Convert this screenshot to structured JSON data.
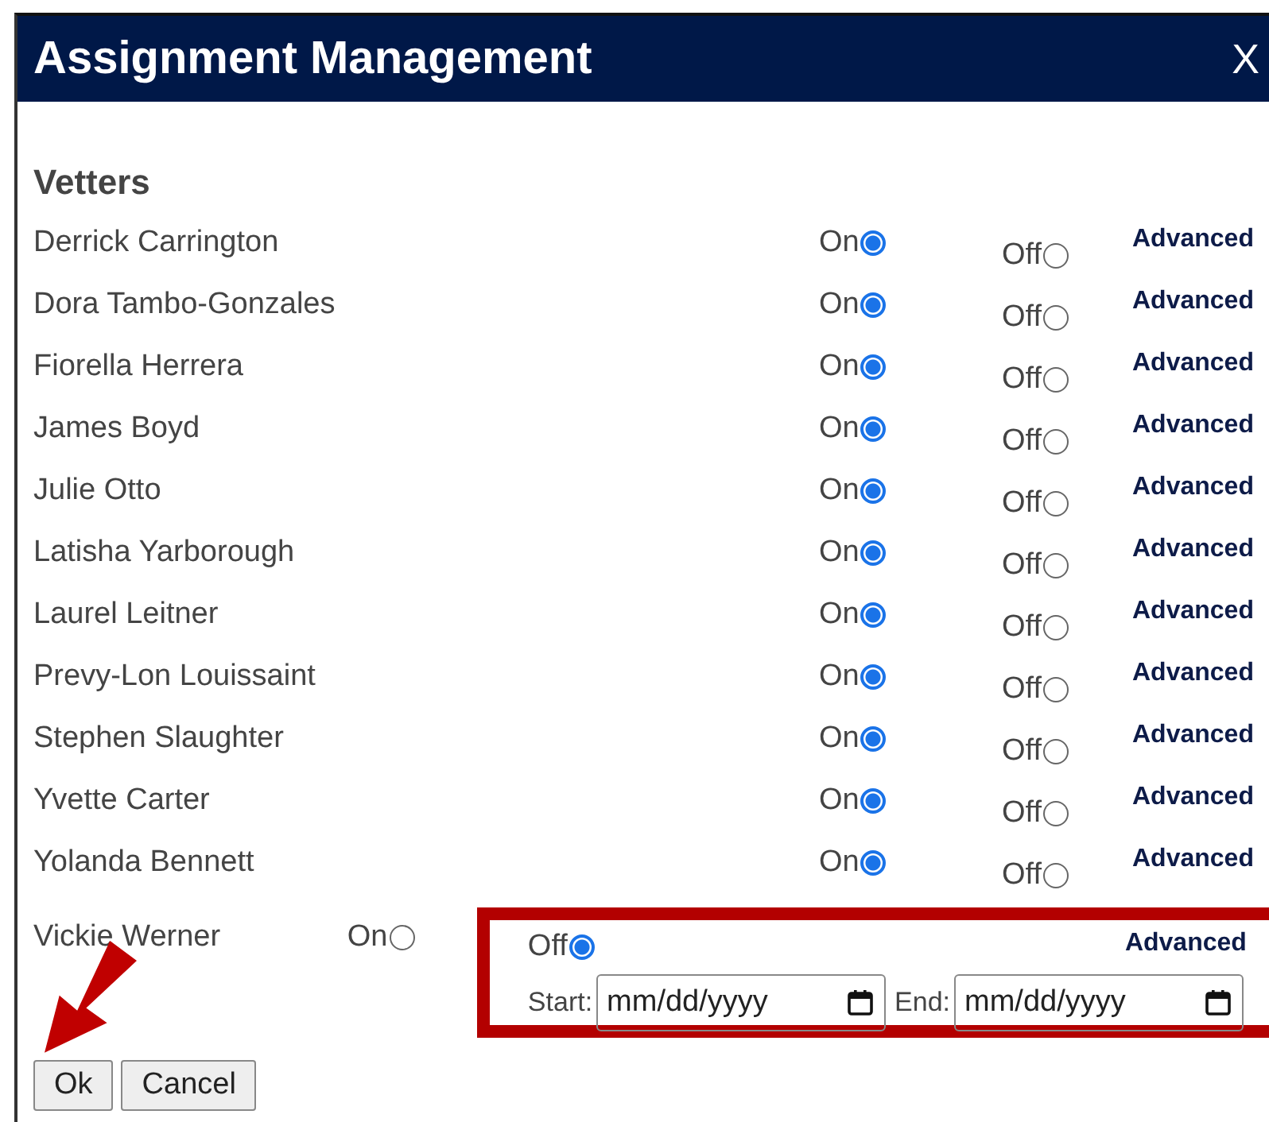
{
  "dialog": {
    "title": "Assignment Management",
    "close": "X"
  },
  "section": "Vetters",
  "vetters": [
    {
      "name": "Derrick Carrington",
      "on_label": "On",
      "off_label": "Off",
      "on": true,
      "advanced": "Advanced",
      "expanded": false
    },
    {
      "name": "Dora Tambo-Gonzales",
      "on_label": "On",
      "off_label": "Off",
      "on": true,
      "advanced": "Advanced",
      "expanded": false
    },
    {
      "name": "Fiorella Herrera",
      "on_label": "On",
      "off_label": "Off",
      "on": true,
      "advanced": "Advanced",
      "expanded": false
    },
    {
      "name": "James Boyd",
      "on_label": "On",
      "off_label": "Off",
      "on": true,
      "advanced": "Advanced",
      "expanded": false
    },
    {
      "name": "Julie Otto",
      "on_label": "On",
      "off_label": "Off",
      "on": true,
      "advanced": "Advanced",
      "expanded": false
    },
    {
      "name": "Latisha Yarborough",
      "on_label": "On",
      "off_label": "Off",
      "on": true,
      "advanced": "Advanced",
      "expanded": false
    },
    {
      "name": "Laurel Leitner",
      "on_label": "On",
      "off_label": "Off",
      "on": true,
      "advanced": "Advanced",
      "expanded": false
    },
    {
      "name": "Prevy-Lon Louissaint",
      "on_label": "On",
      "off_label": "Off",
      "on": true,
      "advanced": "Advanced",
      "expanded": false
    },
    {
      "name": "Stephen Slaughter",
      "on_label": "On",
      "off_label": "Off",
      "on": true,
      "advanced": "Advanced",
      "expanded": false
    },
    {
      "name": "Yvette Carter",
      "on_label": "On",
      "off_label": "Off",
      "on": true,
      "advanced": "Advanced",
      "expanded": false
    },
    {
      "name": "Yolanda Bennett",
      "on_label": "On",
      "off_label": "Off",
      "on": true,
      "advanced": "Advanced",
      "expanded": false
    },
    {
      "name": "Vickie Werner",
      "on_label": "On",
      "off_label": "Off",
      "on": false,
      "advanced": "Advanced",
      "expanded": true,
      "start_label": "Start:",
      "start_placeholder": "mm/dd/yyyy",
      "end_label": "End:",
      "end_placeholder": "mm/dd/yyyy"
    }
  ],
  "buttons": [
    {
      "label": "Ok"
    },
    {
      "label": "Cancel"
    }
  ]
}
